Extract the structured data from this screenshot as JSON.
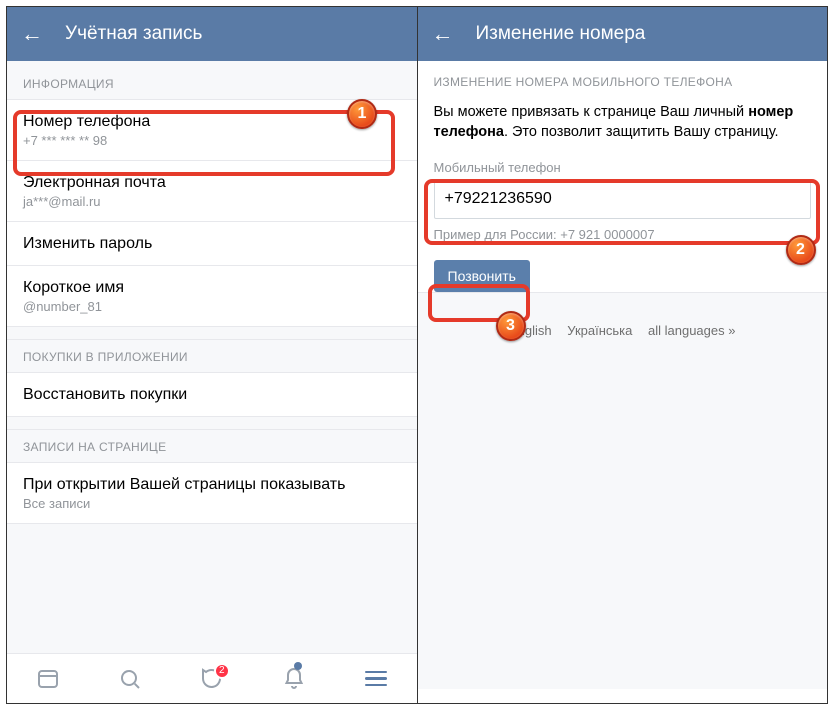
{
  "left": {
    "title": "Учётная запись",
    "section_info": "ИНФОРМАЦИЯ",
    "phone_label": "Номер телефона",
    "phone_value": "+7 *** *** ** 98",
    "email_label": "Электронная почта",
    "email_value": "ja***@mail.ru",
    "password_label": "Изменить пароль",
    "shortname_label": "Короткое имя",
    "shortname_value": "@number_81",
    "section_purchases": "ПОКУПКИ В ПРИЛОЖЕНИИ",
    "restore_label": "Восстановить покупки",
    "section_wall": "ЗАПИСИ НА СТРАНИЦЕ",
    "wall_label": "При открытии Вашей страницы показывать",
    "wall_value": "Все записи",
    "badge_count": "2"
  },
  "right": {
    "title": "Изменение номера",
    "caption": "ИЗМЕНЕНИЕ НОМЕРА МОБИЛЬНОГО ТЕЛЕФОНА",
    "desc_pre": "Вы можете привязать к странице Ваш личный ",
    "desc_bold": "номер телефона",
    "desc_post": ". Это позволит защитить Вашу страницу.",
    "field_label": "Мобильный телефон",
    "field_value": "+79221236590",
    "hint": "Пример для России: +7 921 0000007",
    "call_btn": "Позвонить",
    "lang1": "English",
    "lang2": "Українська",
    "lang3": "all languages »"
  },
  "callouts": {
    "n1": "1",
    "n2": "2",
    "n3": "3"
  }
}
